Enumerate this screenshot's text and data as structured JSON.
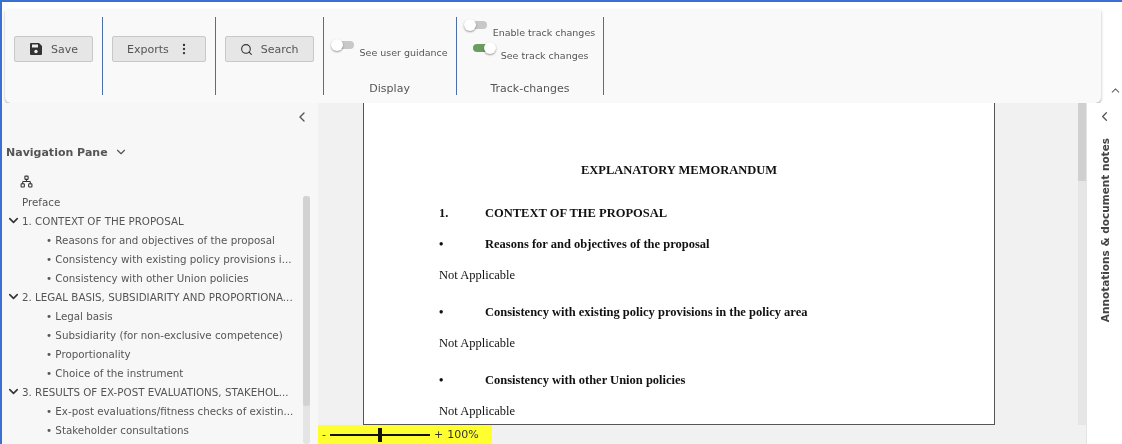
{
  "toolbar": {
    "buttons": [
      {
        "kind": "save",
        "label": "Save"
      },
      {
        "kind": "menu",
        "label": "Exports"
      },
      {
        "kind": "search",
        "label": "Search"
      }
    ],
    "groups": [
      {
        "title": "Display",
        "toggles": [
          {
            "label": "See user guidance",
            "on": false
          }
        ]
      },
      {
        "title": "Track-changes",
        "toggles": [
          {
            "label": "Enable track changes",
            "on": false
          },
          {
            "label": "See track changes",
            "on": true
          }
        ]
      }
    ]
  },
  "navigation": {
    "title": "Navigation Pane",
    "items": [
      {
        "label": "Preface"
      },
      {
        "label": "1. CONTEXT OF THE PROPOSAL",
        "expanded": true,
        "children": [
          {
            "bullet": "•",
            "label": "Reasons for and objectives of the proposal"
          },
          {
            "bullet": "•",
            "label": "Consistency with existing policy provisions i..."
          },
          {
            "bullet": "•",
            "label": "Consistency with other Union policies"
          }
        ]
      },
      {
        "label": "2. LEGAL BASIS, SUBSIDIARITY AND PROPORTIONA...",
        "expanded": true,
        "children": [
          {
            "bullet": "•",
            "label": "Legal basis"
          },
          {
            "bullet": "•",
            "label": "Subsidiarity (for non-exclusive competence)"
          },
          {
            "bullet": "•",
            "label": "Proportionality"
          },
          {
            "bullet": "•",
            "label": "Choice of the instrument"
          }
        ]
      },
      {
        "label": "3. RESULTS OF EX-POST EVALUATIONS, STAKEHOL...",
        "expanded": true,
        "children": [
          {
            "bullet": "•",
            "label": "Ex-post evaluations/fitness checks of existin..."
          },
          {
            "bullet": "•",
            "label": "Stakeholder consultations"
          }
        ]
      }
    ]
  },
  "document": {
    "blocks": [
      {
        "kind": "heading",
        "text": "EXPLANATORY MEMORANDUM"
      },
      {
        "kind": "section",
        "number": "1.",
        "text": "CONTEXT OF THE PROPOSAL"
      },
      {
        "kind": "bullet",
        "number": "•",
        "text": "Reasons for and objectives of the proposal"
      },
      {
        "kind": "paragraph",
        "text": "Not Applicable"
      },
      {
        "kind": "bullet",
        "number": "•",
        "text": "Consistency with existing policy provisions in the policy area"
      },
      {
        "kind": "paragraph",
        "text": "Not Applicable"
      },
      {
        "kind": "bullet",
        "number": "•",
        "text": "Consistency with other Union policies"
      },
      {
        "kind": "paragraph",
        "text": "Not Applicable"
      }
    ]
  },
  "zoom": {
    "minus": "-",
    "plus": "+",
    "reading": "100%",
    "level": 0.5
  },
  "annotations": {
    "title": "Annotations & document notes"
  }
}
